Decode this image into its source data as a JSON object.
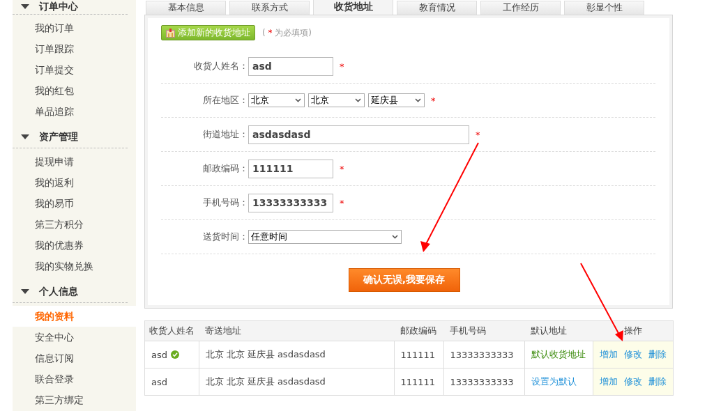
{
  "sidebar": {
    "sections": [
      {
        "title": "订单中心",
        "expanded": true,
        "items": [
          {
            "label": "我的订单",
            "selected": false
          },
          {
            "label": "订单跟踪",
            "selected": false
          },
          {
            "label": "订单提交",
            "selected": false
          },
          {
            "label": "我的红包",
            "selected": false
          },
          {
            "label": "单品追踪",
            "selected": false
          }
        ]
      },
      {
        "title": "资产管理",
        "expanded": true,
        "items": [
          {
            "label": "提现申请",
            "selected": false
          },
          {
            "label": "我的返利",
            "selected": false
          },
          {
            "label": "我的易币",
            "selected": false
          },
          {
            "label": "第三方积分",
            "selected": false
          },
          {
            "label": "我的优惠券",
            "selected": false
          },
          {
            "label": "我的实物兑换",
            "selected": false
          }
        ]
      },
      {
        "title": "个人信息",
        "expanded": true,
        "items": [
          {
            "label": "我的资料",
            "selected": true
          },
          {
            "label": "安全中心",
            "selected": false
          },
          {
            "label": "信息订阅",
            "selected": false
          },
          {
            "label": "联合登录",
            "selected": false
          },
          {
            "label": "第三方绑定",
            "selected": false
          }
        ]
      }
    ]
  },
  "tabs": [
    {
      "label": "基本信息",
      "selected": false
    },
    {
      "label": "联系方式",
      "selected": false
    },
    {
      "label": "收货地址",
      "selected": true
    },
    {
      "label": "教育情况",
      "selected": false
    },
    {
      "label": "工作经历",
      "selected": false
    },
    {
      "label": "彰显个性",
      "selected": false
    }
  ],
  "add_button": "添加新的收货地址",
  "required_note": {
    "open": "(",
    "mark": "*",
    "text": "为必填项)"
  },
  "form": [
    {
      "kind": "text",
      "label": "收货人姓名：",
      "value": "asd",
      "required": true
    },
    {
      "kind": "selects",
      "label": "所在地区：",
      "values": [
        "北京",
        "北京",
        "延庆县"
      ],
      "required": true
    },
    {
      "kind": "longtext",
      "label": "街道地址：",
      "value": "asdasdasd",
      "required": true
    },
    {
      "kind": "text",
      "label": "邮政编码：",
      "value": "111111",
      "required": true
    },
    {
      "kind": "text",
      "label": "手机号码：",
      "value": "13333333333",
      "required": true
    },
    {
      "kind": "select",
      "label": "送货时间：",
      "value": "任意时间",
      "required": false
    }
  ],
  "required_mark": "*",
  "save_button": "确认无误,我要保存",
  "table": {
    "columns": [
      "收货人姓名",
      "寄送地址",
      "邮政编码",
      "手机号码",
      "默认地址",
      "操作"
    ],
    "rows": [
      {
        "name": "asd",
        "address": "北京 北京 延庆县 asdasdasd",
        "postcode": "111111",
        "phone": "13333333333",
        "is_default": true,
        "default_text": "默认收货地址",
        "actions": [
          "增加",
          "修改",
          "删除"
        ]
      },
      {
        "name": "asd",
        "address": "北京 北京 延庆县 asdasdasd",
        "postcode": "111111",
        "phone": "13333333333",
        "is_default": false,
        "default_text": "设置为默认",
        "actions": [
          "增加",
          "修改",
          "删除"
        ]
      }
    ]
  }
}
